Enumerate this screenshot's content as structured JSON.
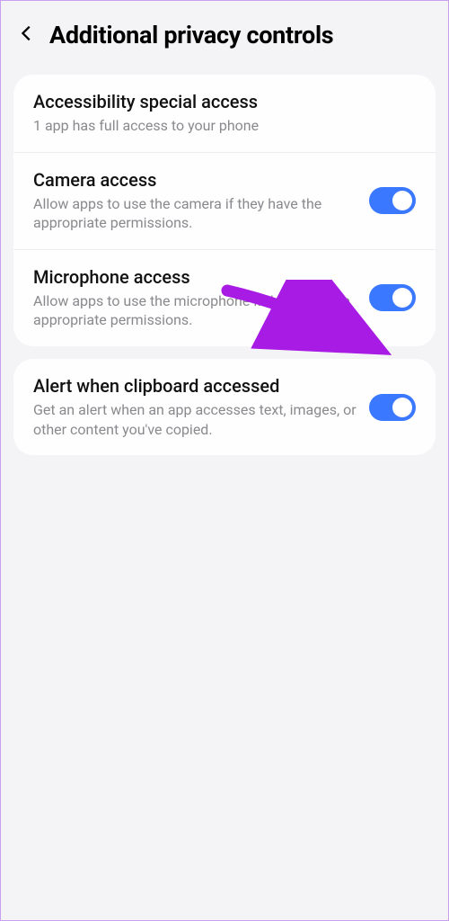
{
  "header": {
    "title": "Additional privacy controls"
  },
  "groups": [
    {
      "items": [
        {
          "name": "accessibility-special-access",
          "title": "Accessibility special access",
          "description": "1 app has full access to your phone",
          "has_toggle": false,
          "toggle_on": false
        },
        {
          "name": "camera-access",
          "title": "Camera access",
          "description": "Allow apps to use the camera if they have the appropriate permissions.",
          "has_toggle": true,
          "toggle_on": true
        },
        {
          "name": "microphone-access",
          "title": "Microphone access",
          "description": "Allow apps to use the microphone if they have the appropriate permissions.",
          "has_toggle": true,
          "toggle_on": true
        }
      ]
    },
    {
      "items": [
        {
          "name": "alert-clipboard-accessed",
          "title": "Alert when clipboard accessed",
          "description": "Get an alert when an app accesses text, images, or other content you've copied.",
          "has_toggle": true,
          "toggle_on": true
        }
      ]
    }
  ],
  "colors": {
    "accent": "#3a78ff",
    "annotation": "#a81be4"
  },
  "annotation": {
    "target": "microphone-access-toggle"
  }
}
